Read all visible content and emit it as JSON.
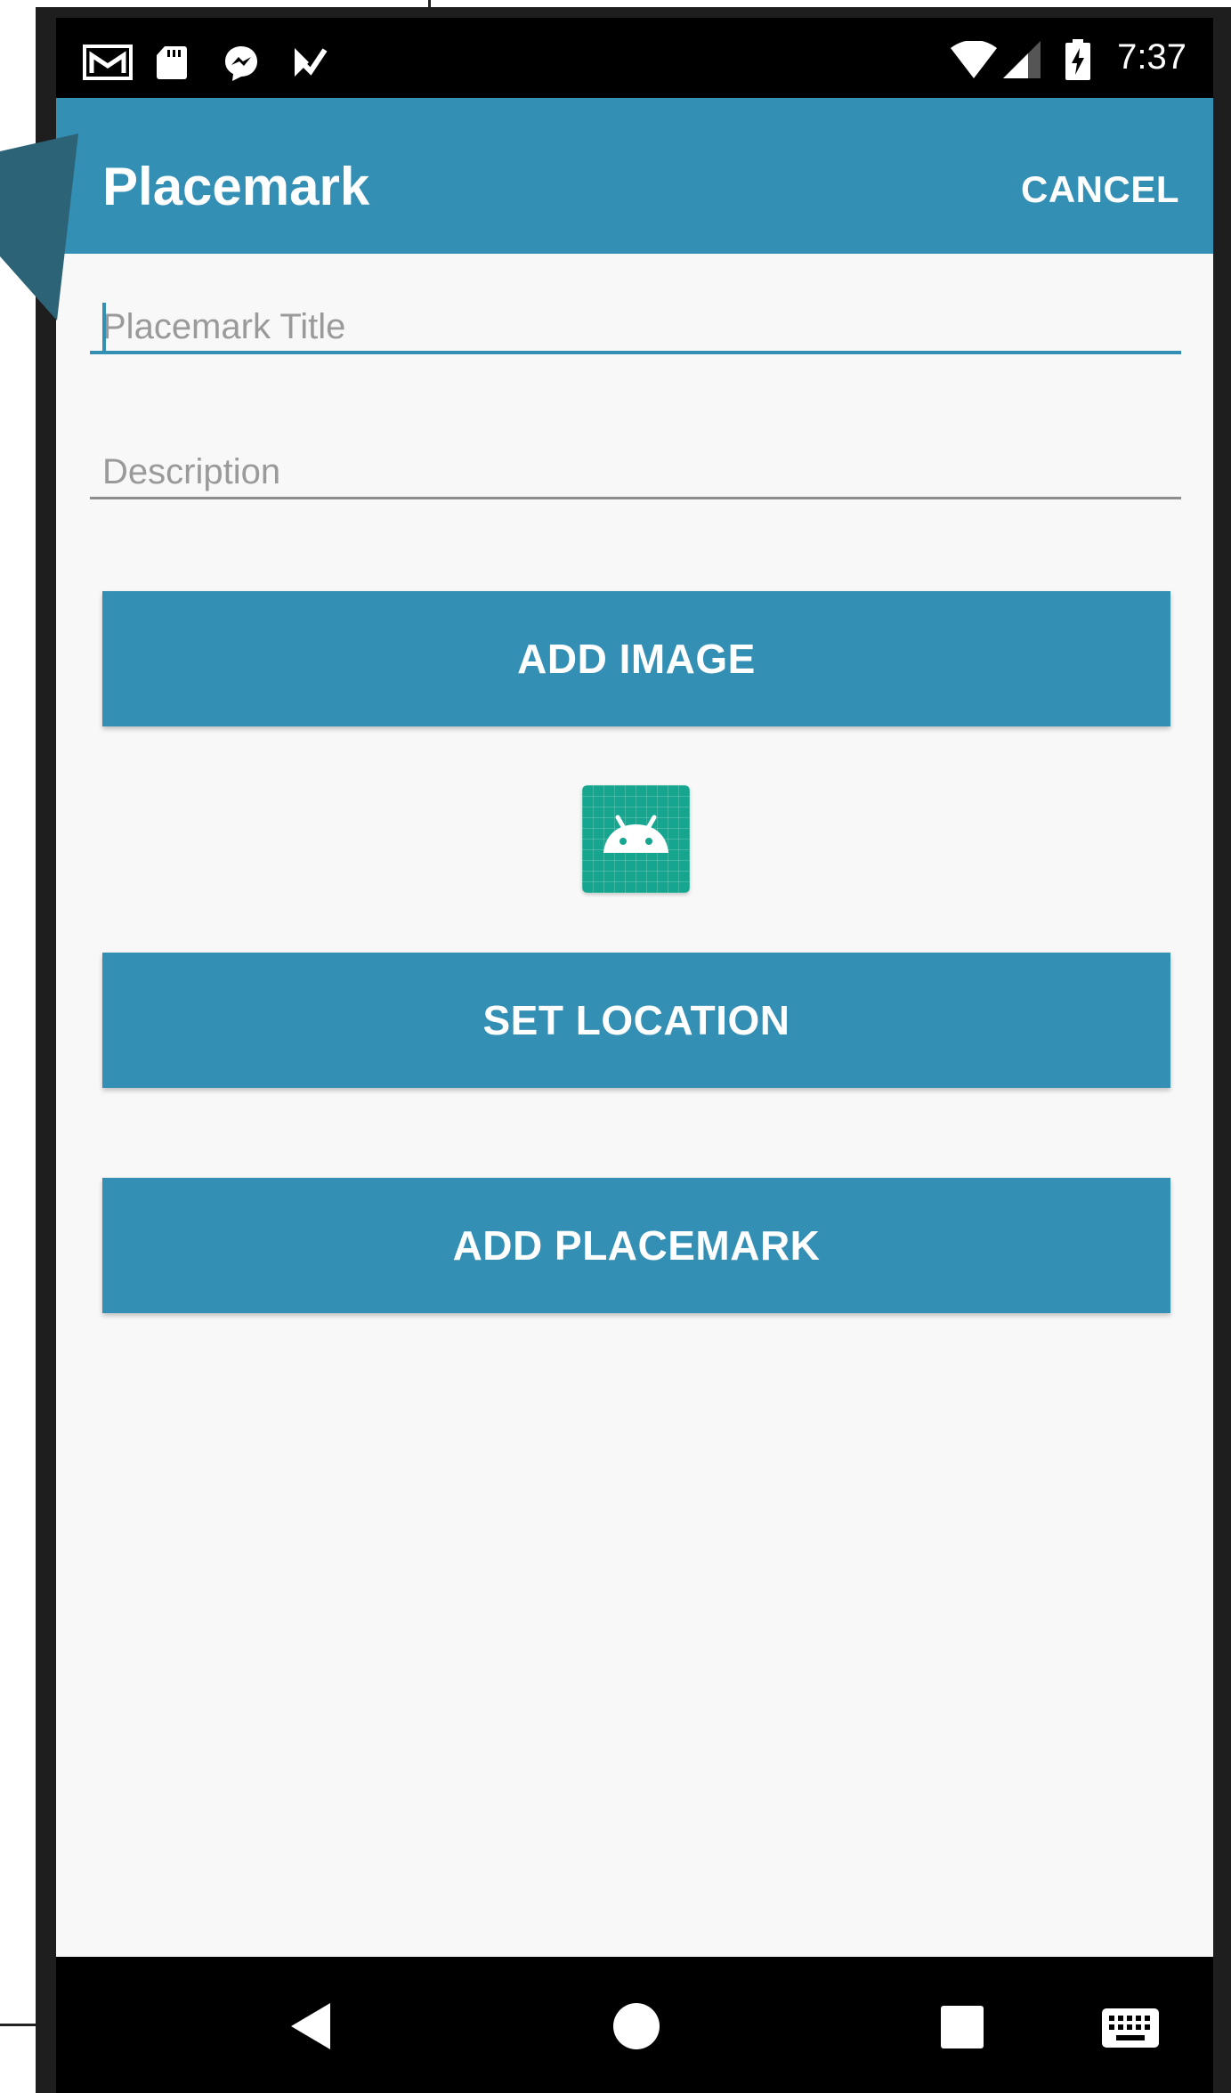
{
  "status_bar": {
    "time": "7:37",
    "left_icons": [
      "gmail-icon",
      "sd-card-icon",
      "messenger-icon",
      "check-notification-icon"
    ],
    "right_icons": [
      "wifi-icon",
      "cell-signal-icon",
      "battery-charging-icon"
    ]
  },
  "app_bar": {
    "title": "Placemark",
    "action_label": "CANCEL"
  },
  "form": {
    "title_field": {
      "value": "",
      "placeholder": "Placemark Title"
    },
    "description_field": {
      "value": "",
      "placeholder": "Description"
    }
  },
  "buttons": {
    "add_image": "ADD IMAGE",
    "set_location": "SET LOCATION",
    "add_placemark": "ADD PLACEMARK"
  },
  "image_preview": {
    "icon": "android-icon"
  },
  "nav_bar": {
    "items": [
      "back-icon",
      "home-icon",
      "recents-icon",
      "keyboard-icon"
    ]
  },
  "colors": {
    "primary": "#348fb5",
    "background": "#f8f8f8",
    "preview": "#16a68f"
  }
}
